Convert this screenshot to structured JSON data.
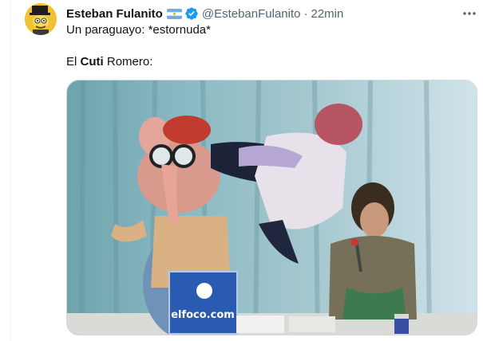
{
  "tweet": {
    "display_name": "Esteban Fulanito",
    "handle": "@EstebanFulanito",
    "separator": "·",
    "time": "22min",
    "text_line1": "Un paraguayo: *estornuda*",
    "text_line2_prefix": "El ",
    "text_line2_bold": "Cuti",
    "text_line2_suffix": " Romero:",
    "icons": {
      "flag": "argentina-flag-icon",
      "verified": "verified-badge-icon",
      "more": "more-options-icon"
    },
    "colors": {
      "verified": "#1d9bf0",
      "secondary_text": "#536471",
      "flag_blue": "#74acdf",
      "flag_sun": "#f6b40e"
    }
  },
  "media": {
    "sign_text": "elfoco.com"
  }
}
